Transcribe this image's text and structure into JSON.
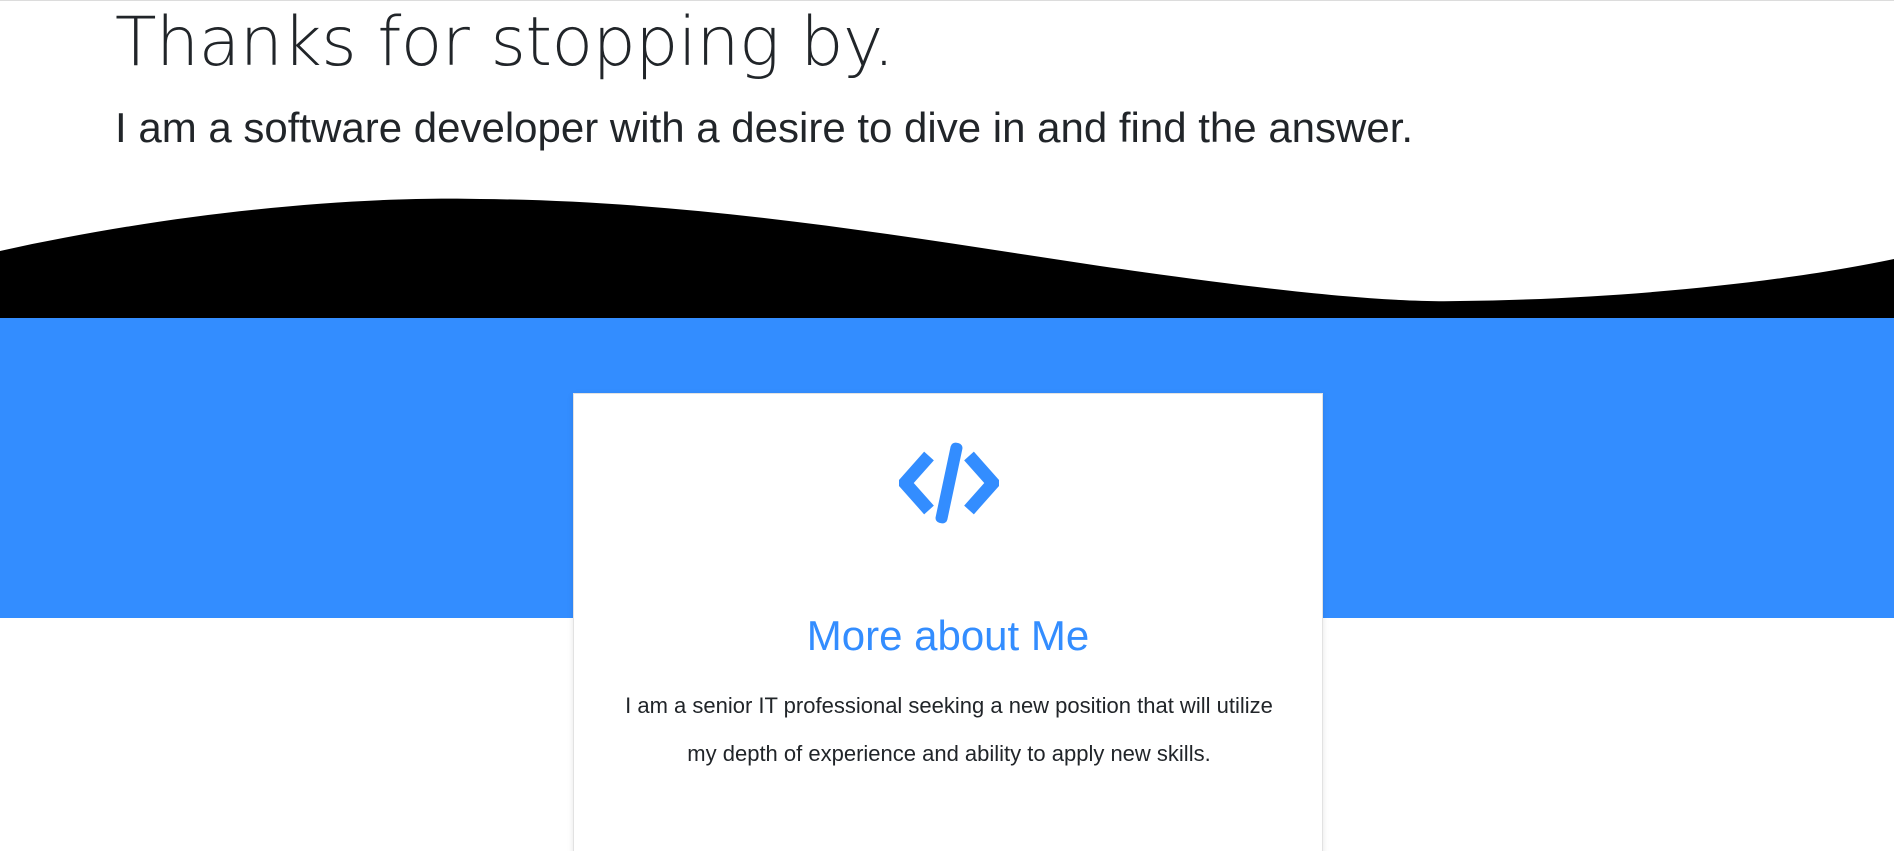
{
  "hero": {
    "title": "Thanks for stopping by.",
    "subtitle": "I am a software developer with a desire to dive in and find the answer."
  },
  "about_card": {
    "icon": "code-icon",
    "title": "More about Me",
    "text": "I am a senior IT professional seeking a new position that will utilize my depth of experience and ability to apply new skills."
  },
  "colors": {
    "accent": "#338dff",
    "wave": "#000000",
    "text": "#212529",
    "background": "#ffffff"
  }
}
